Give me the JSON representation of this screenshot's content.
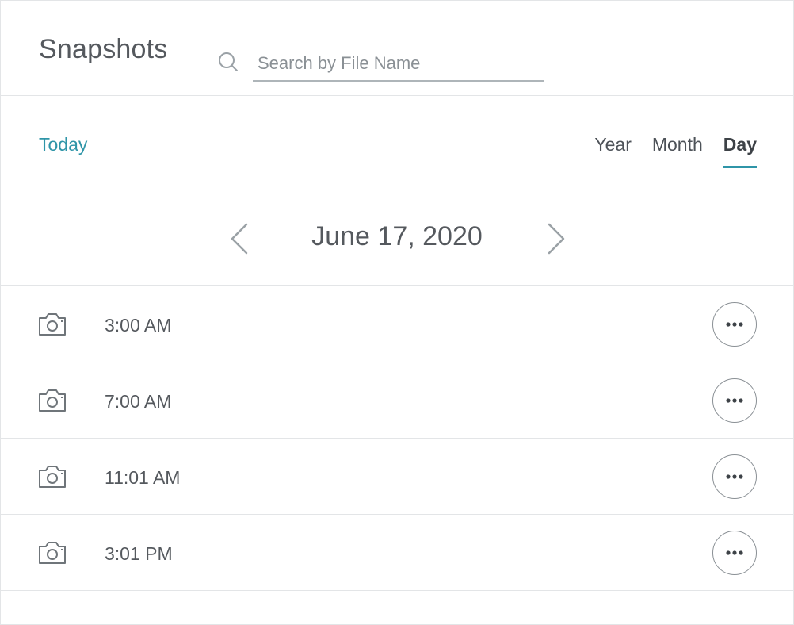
{
  "header": {
    "title": "Snapshots",
    "search_placeholder": "Search by File Name",
    "search_value": ""
  },
  "view_bar": {
    "today_label": "Today",
    "tabs": [
      {
        "label": "Year",
        "active": false
      },
      {
        "label": "Month",
        "active": false
      },
      {
        "label": "Day",
        "active": true
      }
    ]
  },
  "date_nav": {
    "current_date": "June 17, 2020"
  },
  "snapshots": [
    {
      "time": "3:00 AM"
    },
    {
      "time": "7:00 AM"
    },
    {
      "time": "11:01 AM"
    },
    {
      "time": "3:01 PM"
    }
  ],
  "icons": {
    "search": "search-icon",
    "prev": "chevron-left-icon",
    "next": "chevron-right-icon",
    "snapshot": "camera-icon",
    "more": "more-horizontal-icon"
  },
  "colors": {
    "accent": "#2f95a8",
    "text": "#4a4f55",
    "divider": "#e3e5e7"
  }
}
